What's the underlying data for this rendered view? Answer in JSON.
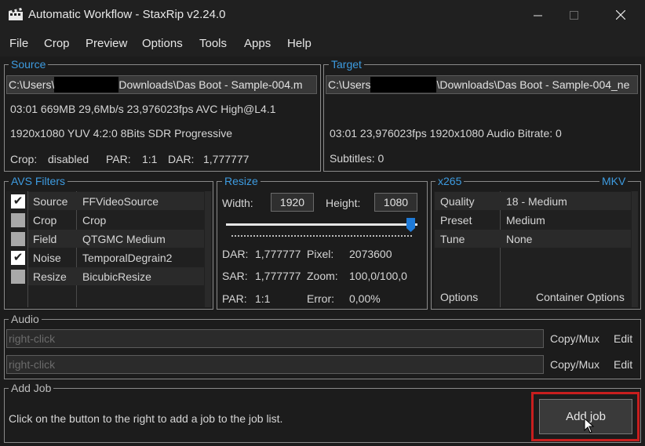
{
  "window": {
    "title": "Automatic Workflow - StaxRip v2.24.0"
  },
  "menu": [
    "File",
    "Crop",
    "Preview",
    "Options",
    "Tools",
    "Apps",
    "Help"
  ],
  "source": {
    "legend": "Source",
    "path_prefix": "C:\\Users\\",
    "path_suffix": "Downloads\\Das Boot - Sample-004.m",
    "info1": "03:01  669MB  29,6Mb/s  23,976023fps  AVC  High@L4.1",
    "info2": "1920x1080  YUV  4:2:0  8Bits  SDR  Progressive",
    "crop_label": "Crop:",
    "crop_value": "disabled",
    "par_label": "PAR:",
    "par_value": "1:1",
    "dar_label": "DAR:",
    "dar_value": "1,777777"
  },
  "target": {
    "legend": "Target",
    "path_prefix": "C:\\Users",
    "path_suffix": "\\Downloads\\Das Boot - Sample-004_ne",
    "info1": "03:01  23,976023fps  1920x1080  Audio Bitrate: 0",
    "subtitles": "Subtitles: 0"
  },
  "avs": {
    "legend": "AVS Filters",
    "rows": [
      {
        "checked": true,
        "mark": "✔",
        "name": "Source",
        "value": "FFVideoSource"
      },
      {
        "checked": false,
        "mark": "",
        "name": "Crop",
        "value": "Crop"
      },
      {
        "checked": false,
        "mark": "",
        "name": "Field",
        "value": "QTGMC Medium"
      },
      {
        "checked": true,
        "mark": "✔",
        "name": "Noise",
        "value": "TemporalDegrain2"
      },
      {
        "checked": false,
        "mark": "",
        "name": "Resize",
        "value": "BicubicResize"
      }
    ]
  },
  "resize": {
    "legend": "Resize",
    "width_label": "Width:",
    "width_value": "1920",
    "height_label": "Height:",
    "height_value": "1080",
    "slider_fraction": 1.0,
    "dar_label": "DAR:",
    "dar_value": "1,777777",
    "pixel_label": "Pixel:",
    "pixel_value": "2073600",
    "sar_label": "SAR:",
    "sar_value": "1,777777",
    "zoom_label": "Zoom:",
    "zoom_value": "100,0/100,0",
    "par_label": "PAR:",
    "par_value": "1:1",
    "error_label": "Error:",
    "error_value": "0,00%"
  },
  "encoder": {
    "legend": "x265",
    "container": "MKV",
    "rows": [
      {
        "name": "Quality",
        "value": "18 - Medium"
      },
      {
        "name": "Preset",
        "value": "Medium"
      },
      {
        "name": "Tune",
        "value": "None"
      }
    ],
    "options_link": "Options",
    "container_options_link": "Container Options"
  },
  "audio": {
    "legend": "Audio",
    "tracks": [
      {
        "placeholder": "right-click",
        "copy": "Copy/Mux",
        "edit": "Edit"
      },
      {
        "placeholder": "right-click",
        "copy": "Copy/Mux",
        "edit": "Edit"
      }
    ]
  },
  "addjob": {
    "legend": "Add Job",
    "hint": "Click on the button to the right to add a job to the job list.",
    "button": "Add job"
  },
  "colors": {
    "accent": "#3d9be0",
    "highlight": "#c81e1e"
  }
}
